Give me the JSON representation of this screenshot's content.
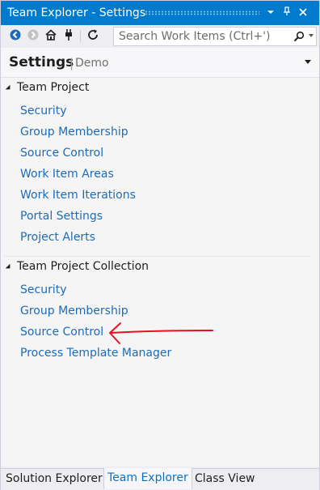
{
  "window": {
    "title": "Team Explorer - Settings"
  },
  "titlebar_buttons": {
    "dropdown": "▾",
    "pin": "𝔭",
    "close": "✕"
  },
  "toolbar": {
    "icons": [
      "back-icon",
      "forward-icon",
      "home-icon",
      "connect-icon",
      "refresh-icon"
    ],
    "search_placeholder": "Search Work Items (Ctrl+')"
  },
  "header": {
    "title": "Settings",
    "separator": "|",
    "context": "Demo"
  },
  "sections": [
    {
      "label": "Team Project",
      "links": [
        "Security",
        "Group Membership",
        "Source Control",
        "Work Item Areas",
        "Work Item Iterations",
        "Portal Settings",
        "Project Alerts"
      ]
    },
    {
      "label": "Team Project Collection",
      "links": [
        "Security",
        "Group Membership",
        "Source Control",
        "Process Template Manager"
      ]
    }
  ],
  "tabs": [
    {
      "label": "Solution Explorer",
      "active": false
    },
    {
      "label": "Team Explorer",
      "active": true
    },
    {
      "label": "Class View",
      "active": false
    }
  ],
  "colors": {
    "accent": "#007acc",
    "link": "#1e6bb8",
    "annotation": "#e81123"
  }
}
